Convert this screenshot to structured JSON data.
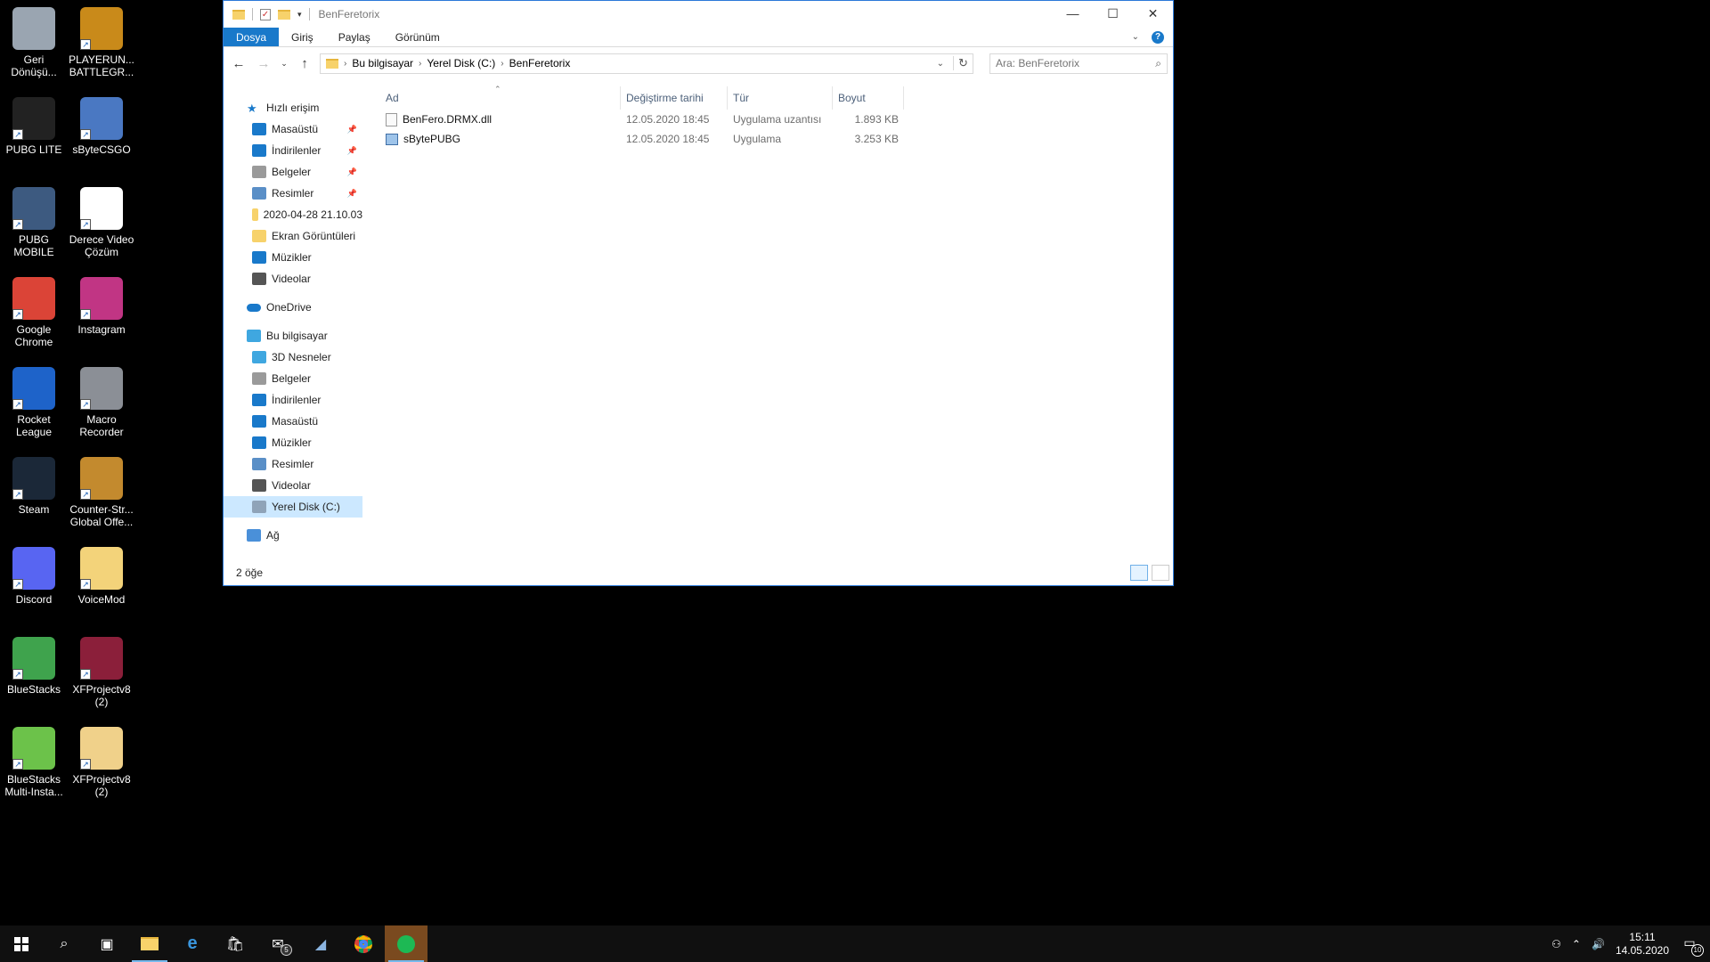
{
  "desktop": {
    "icons": [
      {
        "label": "Geri Dönüşü...",
        "color": "#9aa5b1"
      },
      {
        "label": "PLAYERUN... BATTLEGR...",
        "color": "#c98a1a"
      },
      {
        "label": "PUBG LITE",
        "color": "#222222"
      },
      {
        "label": "sByteCSGO",
        "color": "#4a78c2"
      },
      {
        "label": "PUBG MOBILE",
        "color": "#3d5a80"
      },
      {
        "label": "Derece Video Çözüm",
        "color": "#ffffff"
      },
      {
        "label": "Google Chrome",
        "color": "#db4437"
      },
      {
        "label": "Instagram",
        "color": "#c13584"
      },
      {
        "label": "Rocket League",
        "color": "#1e63c9"
      },
      {
        "label": "Macro Recorder",
        "color": "#8b8f96"
      },
      {
        "label": "Steam",
        "color": "#1b2838"
      },
      {
        "label": "Counter-Str... Global Offe...",
        "color": "#c38a2e"
      },
      {
        "label": "Discord",
        "color": "#5865f2"
      },
      {
        "label": "VoiceMod",
        "color": "#f3d37a"
      },
      {
        "label": "BlueStacks",
        "color": "#3fa34d"
      },
      {
        "label": "XFProjectv8 (2)",
        "color": "#8b1f3a"
      },
      {
        "label": "BlueStacks Multi-Insta...",
        "color": "#6cc24a"
      },
      {
        "label": "XFProjectv8 (2)",
        "color": "#f0d18a"
      }
    ]
  },
  "explorer": {
    "title": "BenFeretorix",
    "controls": {
      "minimize": "—",
      "maximize": "☐",
      "close": "✕"
    },
    "ribbon_tabs": [
      "Dosya",
      "Giriş",
      "Paylaş",
      "Görünüm"
    ],
    "help": "?",
    "breadcrumb": [
      "Bu bilgisayar",
      "Yerel Disk (C:)",
      "BenFeretorix"
    ],
    "search_placeholder": "Ara: BenFeretorix",
    "nav": {
      "quick_access": "Hızlı erişim",
      "quick_items": [
        {
          "label": "Masaüstü",
          "pinned": true,
          "color": "#1979ca"
        },
        {
          "label": "İndirilenler",
          "pinned": true,
          "color": "#1979ca"
        },
        {
          "label": "Belgeler",
          "pinned": true,
          "color": "#9a9a9a"
        },
        {
          "label": "Resimler",
          "pinned": true,
          "color": "#5a8fc7"
        },
        {
          "label": "2020-04-28 21.10.03",
          "pinned": false,
          "color": "#f7d26b"
        },
        {
          "label": "Ekran Görüntüleri",
          "pinned": false,
          "color": "#f7d26b"
        },
        {
          "label": "Müzikler",
          "pinned": false,
          "color": "#1979ca"
        },
        {
          "label": "Videolar",
          "pinned": false,
          "color": "#555555"
        }
      ],
      "onedrive": "OneDrive",
      "this_pc": "Bu bilgisayar",
      "pc_items": [
        {
          "label": "3D Nesneler",
          "color": "#3fa7e0"
        },
        {
          "label": "Belgeler",
          "color": "#9a9a9a"
        },
        {
          "label": "İndirilenler",
          "color": "#1979ca"
        },
        {
          "label": "Masaüstü",
          "color": "#1979ca"
        },
        {
          "label": "Müzikler",
          "color": "#1979ca"
        },
        {
          "label": "Resimler",
          "color": "#5a8fc7"
        },
        {
          "label": "Videolar",
          "color": "#555555"
        },
        {
          "label": "Yerel Disk (C:)",
          "color": "#8fa3b8",
          "selected": true
        }
      ],
      "network": "Ağ"
    },
    "columns": {
      "name": "Ad",
      "date": "Değiştirme tarihi",
      "type": "Tür",
      "size": "Boyut"
    },
    "files": [
      {
        "name": "BenFero.DRMX.dll",
        "date": "12.05.2020 18:45",
        "type": "Uygulama uzantısı",
        "size": "1.893 KB",
        "kind": "dll"
      },
      {
        "name": "sBytePUBG",
        "date": "12.05.2020 18:45",
        "type": "Uygulama",
        "size": "3.253 KB",
        "kind": "exe"
      }
    ],
    "status": "2 öğe"
  },
  "taskbar": {
    "mail_badge": "5",
    "clock_time": "15:11",
    "clock_date": "14.05.2020",
    "notifications": "10"
  }
}
